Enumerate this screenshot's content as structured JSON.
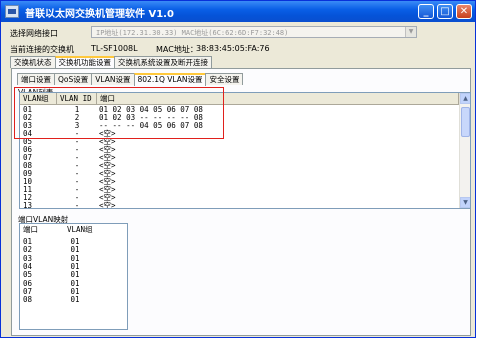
{
  "window": {
    "title": "普联以太网交换机管理软件 V1.0",
    "min_symbol": "_",
    "max_symbol": "□",
    "close_symbol": "✕"
  },
  "interface": {
    "label": "选择网络接口",
    "selected": "IP地址(172.31.30.33)    MAC地址(6C:62:6D:F7:32:48)"
  },
  "connected": {
    "label": "当前连接的交换机",
    "model": "TL-SF1008L",
    "mac_label": "MAC地址：",
    "mac": "38:83:45:05:FA:76"
  },
  "main_tabs": [
    "交换机状态",
    "交换机功能设置",
    "交换机系统设置及断开连接"
  ],
  "sub_tabs": [
    "端口设置",
    "QoS设置",
    "VLAN设置",
    "802.1Q VLAN设置",
    "安全设置"
  ],
  "vlan_list": {
    "title": "VLAN列表",
    "columns": [
      "VLAN组",
      "VLAN ID",
      "端口"
    ],
    "rows": [
      {
        "group": "01",
        "id": "1",
        "ports": "01 02 03 04 05 06 07 08"
      },
      {
        "group": "02",
        "id": "2",
        "ports": "01 02 03 -- -- -- -- 08"
      },
      {
        "group": "03",
        "id": "3",
        "ports": "-- -- -- 04 05 06 07 08"
      },
      {
        "group": "04",
        "id": "-",
        "ports": "<空>"
      },
      {
        "group": "05",
        "id": "-",
        "ports": "<空>"
      },
      {
        "group": "06",
        "id": "-",
        "ports": "<空>"
      },
      {
        "group": "07",
        "id": "-",
        "ports": "<空>"
      },
      {
        "group": "08",
        "id": "-",
        "ports": "<空>"
      },
      {
        "group": "09",
        "id": "-",
        "ports": "<空>"
      },
      {
        "group": "10",
        "id": "-",
        "ports": "<空>"
      },
      {
        "group": "11",
        "id": "-",
        "ports": "<空>"
      },
      {
        "group": "12",
        "id": "-",
        "ports": "<空>"
      },
      {
        "group": "13",
        "id": "-",
        "ports": "<空>"
      }
    ]
  },
  "port_map": {
    "title": "端口VLAN映射",
    "columns": [
      "端口",
      "VLAN组"
    ],
    "rows": [
      {
        "port": "01",
        "group": "01"
      },
      {
        "port": "02",
        "group": "01"
      },
      {
        "port": "03",
        "group": "01"
      },
      {
        "port": "04",
        "group": "01"
      },
      {
        "port": "05",
        "group": "01"
      },
      {
        "port": "06",
        "group": "01"
      },
      {
        "port": "07",
        "group": "01"
      },
      {
        "port": "08",
        "group": "01"
      }
    ]
  },
  "scroll": {
    "up": "▲",
    "down": "▼"
  },
  "colors": {
    "title_bar": "#0553d8",
    "highlight_box": "#e0201c",
    "window_bg": "#ece9d8"
  }
}
